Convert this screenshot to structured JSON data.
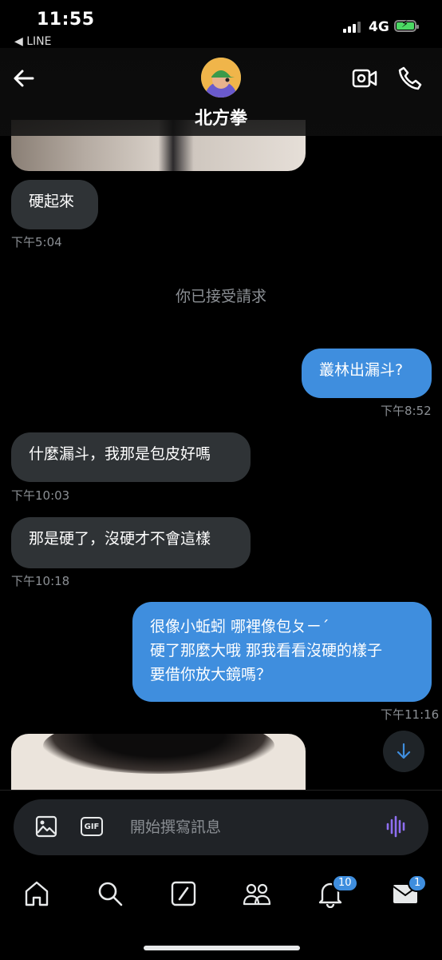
{
  "status_bar": {
    "time": "11:55",
    "back_app": "◀ LINE",
    "network": "4G"
  },
  "header": {
    "title": "北方拳"
  },
  "messages": [
    {
      "text": "硬起來",
      "time": "下午5:04"
    },
    {
      "text": "你已接受請求"
    },
    {
      "text": "叢林出漏斗?",
      "time": "下午8:52"
    },
    {
      "text": "什麼漏斗，我那是包皮好嗎",
      "time": "下午10:03"
    },
    {
      "text": "那是硬了，沒硬才不會這樣",
      "time": "下午10:18"
    },
    {
      "lines": [
        "很像小蚯蚓 哪裡像包ㄆㄧˊ",
        "硬了那麼大哦 那我看看沒硬的樣子",
        "要借你放大鏡嗎？"
      ],
      "time": "下午11:16"
    }
  ],
  "composer": {
    "placeholder": "開始撰寫訊息",
    "gif_label": "GIF"
  },
  "tabs": {
    "notifications_badge": "10",
    "messages_badge": "1"
  },
  "colors": {
    "outgoing_bubble": "#3f8ede",
    "incoming_bubble": "#2f3336",
    "badge": "#3f8ede"
  }
}
